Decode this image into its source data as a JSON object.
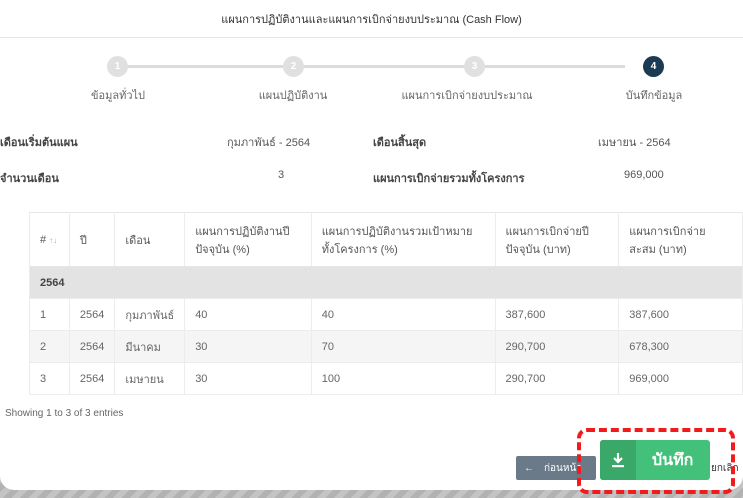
{
  "header": {
    "title": "แผนการปฏิบัติงานและแผนการเบิกจ่ายงบประมาณ (Cash Flow)"
  },
  "stepper": [
    {
      "num": "1",
      "label": "ข้อมูลทั่วไป"
    },
    {
      "num": "2",
      "label": "แผนปฏิบัติงาน"
    },
    {
      "num": "3",
      "label": "แผนการเบิกจ่ายงบประมาณ"
    },
    {
      "num": "4",
      "label": "บันทึกข้อมูล"
    }
  ],
  "info": {
    "start_label": "เดือนเริ่มต้นแผน",
    "start_value": "กุมภาพันธ์ - 2564",
    "end_label": "เดือนสิ้นสุด",
    "end_value": "เมษายน - 2564",
    "months_label": "จำนวนเดือน",
    "months_value": "3",
    "total_label": "แผนการเบิกจ่ายรวมทั้งโครงการ",
    "total_value": "969,000"
  },
  "table": {
    "headers": [
      "#",
      "ปี",
      "เดือน",
      "แผนการปฏิบัติงานปีปัจจุบัน (%)",
      "แผนการปฏิบัติงานรวมเป้าหมายทั้งโครงการ (%)",
      "แผนการเบิกจ่ายปีปัจจุบัน (บาท)",
      "แผนการเบิกจ่ายสะสม (บาท)"
    ],
    "group": "2564",
    "rows": [
      [
        "1",
        "2564",
        "กุมภาพันธ์",
        "40",
        "40",
        "387,600",
        "387,600"
      ],
      [
        "2",
        "2564",
        "มีนาคม",
        "30",
        "70",
        "290,700",
        "678,300"
      ],
      [
        "3",
        "2564",
        "เมษายน",
        "30",
        "100",
        "290,700",
        "969,000"
      ]
    ],
    "footer": "Showing 1 to 3 of 3 entries"
  },
  "buttons": {
    "back": "ก่อนหน้า",
    "save": "บันทึก",
    "cancel": "ยกเลิก"
  },
  "colors": {
    "accent": "#43c17a",
    "step_active": "#1c3b52",
    "highlight": "#f21a1a"
  }
}
